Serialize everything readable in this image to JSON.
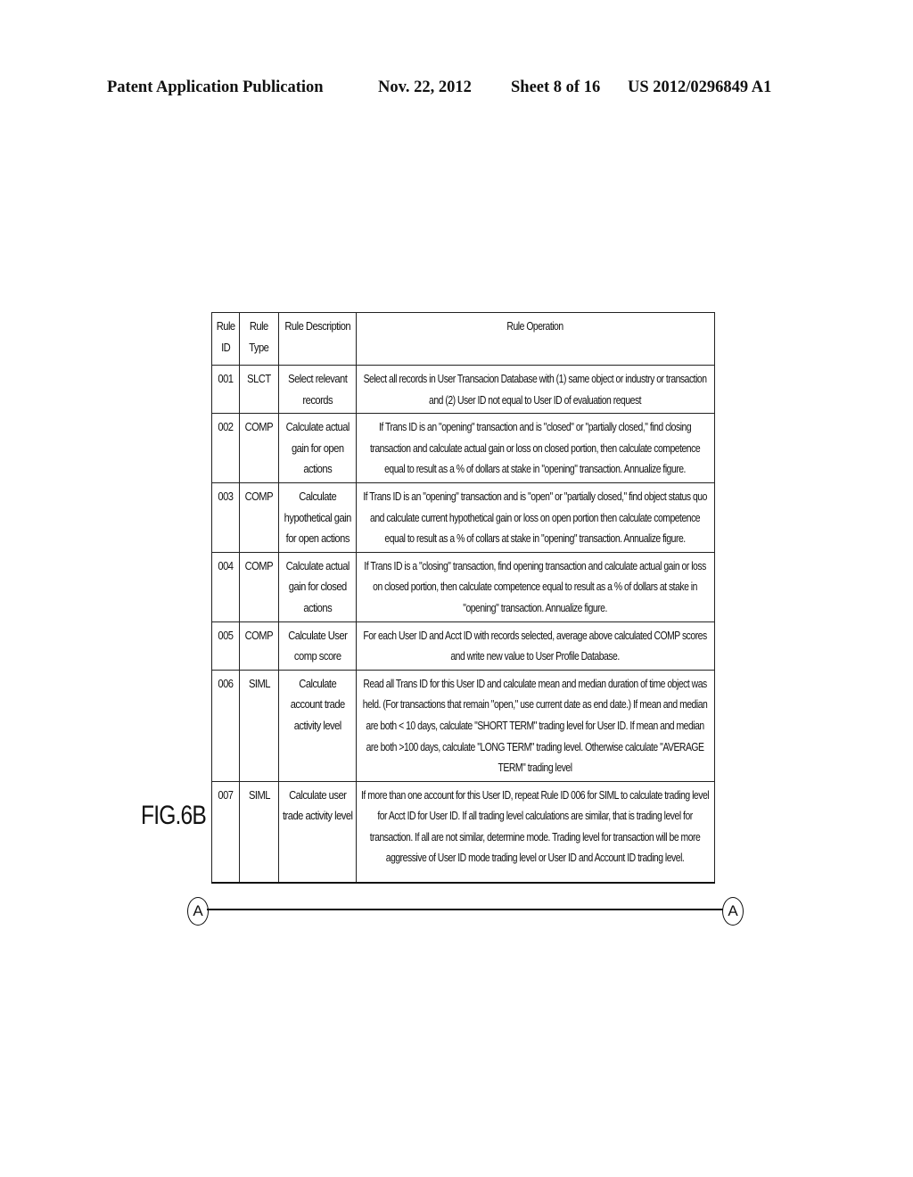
{
  "header": {
    "publication": "Patent Application Publication",
    "date": "Nov. 22, 2012",
    "sheet": "Sheet 8 of 16",
    "number": "US 2012/0296849 A1"
  },
  "figure": {
    "label": "FIG.6B",
    "connector_left": "A",
    "connector_right": "A"
  },
  "table": {
    "columns": [
      "Rule ID",
      "Rule Type",
      "Rule Description",
      "Rule Operation"
    ],
    "rows": [
      {
        "id": "001",
        "type": "SLCT",
        "description": "Select relevant records",
        "operation": "Select all records in User Transacion Database with (1) same object or industry or transaction and (2) User ID not equal to User ID of evaluation request"
      },
      {
        "id": "002",
        "type": "COMP",
        "description": "Calculate actual gain for open actions",
        "operation": "If Trans ID is an \"opening\" transaction and is \"closed\" or \"partially closed,\" find closing transaction and calculate actual gain or loss on closed portion, then calculate competence equal to result as a % of dollars at stake in \"opening\" transaction. Annualize figure."
      },
      {
        "id": "003",
        "type": "COMP",
        "description": "Calculate hypothetical gain for open actions",
        "operation": "If Trans ID is an \"opening\" transaction and is \"open\" or \"partially closed,\" find object status quo and calculate current hypothetical gain or loss on open portion then calculate competence equal to result as a % of collars at stake in \"opening\" transaction. Annualize figure."
      },
      {
        "id": "004",
        "type": "COMP",
        "description": "Calculate actual gain for closed actions",
        "operation": "If Trans ID is a \"closing\" transaction, find opening transaction and calculate actual gain or loss on closed portion, then calculate competence equal to result as a % of dollars at stake in \"opening\" transaction. Annualize figure."
      },
      {
        "id": "005",
        "type": "COMP",
        "description": "Calculate User comp score",
        "operation": "For each User ID and Acct ID with records selected, average above calculated COMP scores and write new value to User Profile Database."
      },
      {
        "id": "006",
        "type": "SIML",
        "description": "Calculate account trade activity level",
        "operation": "Read all Trans ID for this User ID and calculate mean and median duration of time object was held. (For transactions that remain \"open,\" use current date as end date.) If mean and median are both < 10 days, calculate \"SHORT TERM\" trading level for User ID. If mean and median are both >100 days, calculate \"LONG TERM\" trading level. Otherwise calculate \"AVERAGE TERM\" trading level"
      },
      {
        "id": "007",
        "type": "SIML",
        "description": "Calculate user trade activity level",
        "operation": "If more than one account for this User ID, repeat Rule ID 006 for SIML to calculate trading level for Acct ID for User ID. If all trading level calculations are similar, that is trading level for transaction. If all are not similar, determine mode. Trading level for transaction will be more aggressive of User ID mode trading level or User ID and Account ID trading level."
      }
    ]
  }
}
